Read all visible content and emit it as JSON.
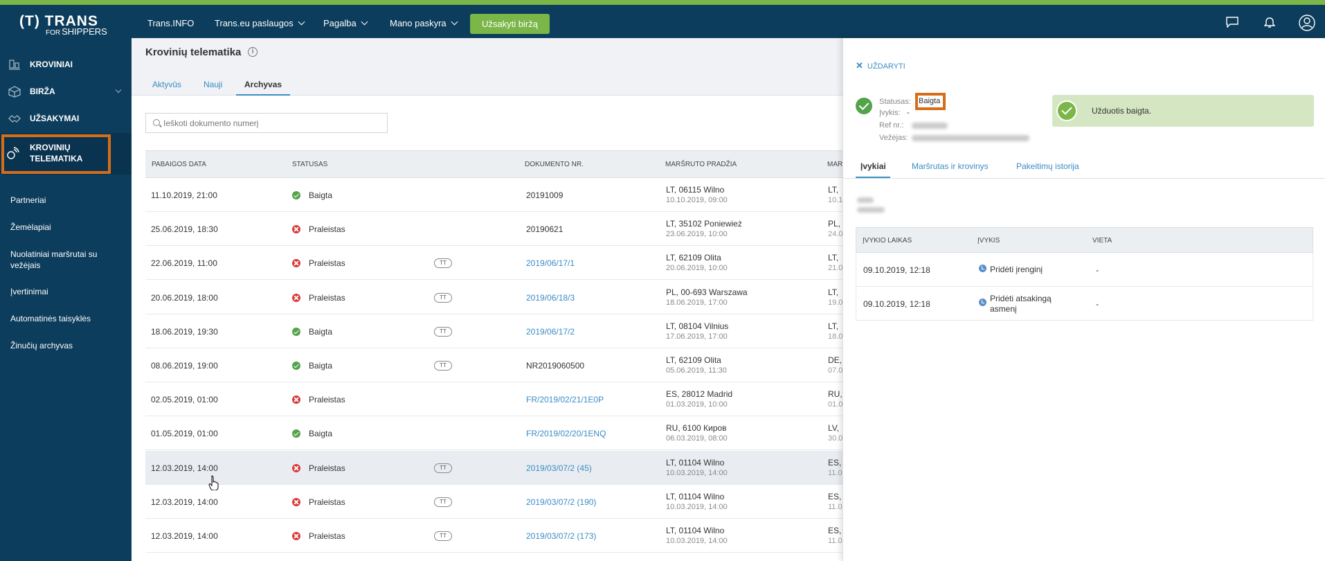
{
  "app": {
    "logo_main": "(T) TRANS",
    "logo_for": "FOR",
    "logo_sub": "SHIPPERS"
  },
  "topnav": {
    "items": [
      {
        "label": "Trans.INFO"
      },
      {
        "label": "Trans.eu paslaugos"
      },
      {
        "label": "Pagalba"
      },
      {
        "label": "Mano paskyra"
      }
    ],
    "order_button": "Užsakyti biržą",
    "icons": [
      "chat-icon",
      "bell-icon",
      "user-icon"
    ]
  },
  "sidebar": {
    "main_items": [
      {
        "label": "KROVINIAI",
        "icon": "cargo-icon"
      },
      {
        "label": "BIRŽA",
        "icon": "box-icon"
      },
      {
        "label": "UŽSAKYMAI",
        "icon": "handshake-icon"
      },
      {
        "label": "KROVINIŲ TELEMATIKA",
        "icon": "satellite-icon"
      }
    ],
    "links": [
      "Partneriai",
      "Žemėlapiai",
      "Nuolatiniai maršrutai su vežėjais",
      "Įvertinimai",
      "Automatinės taisyklės",
      "Žinučių archyvas"
    ]
  },
  "main": {
    "title": "Krovinių telematika",
    "tabs": [
      "Aktyvūs",
      "Nauji",
      "Archyvas"
    ],
    "active_tab": "Archyvas",
    "search_placeholder": "Ieškoti dokumento numerį",
    "columns": [
      "PABAIGOS DATA",
      "STATUSAS",
      "DOKUMENTO NR.",
      "MARŠRUTO PRADŽIA",
      "MARŠ"
    ],
    "rows": [
      {
        "date": "11.10.2019, 21:00",
        "status": "Baigta",
        "ok": true,
        "tt": false,
        "doc": "20191009",
        "link": false,
        "route_from": "LT, 06115 Wilno",
        "route_from_date": "10.10.2019, 09:00",
        "route_to": "LT,",
        "route_to_date": "10.1"
      },
      {
        "date": "25.06.2019, 18:30",
        "status": "Praleistas",
        "ok": false,
        "tt": false,
        "doc": "20190621",
        "link": false,
        "route_from": "LT, 35102 Poniewież",
        "route_from_date": "23.06.2019, 10:00",
        "route_to": "PL,",
        "route_to_date": "24.0"
      },
      {
        "date": "22.06.2019, 11:00",
        "status": "Praleistas",
        "ok": false,
        "tt": true,
        "doc": "2019/06/17/1",
        "link": true,
        "route_from": "LT, 62109 Olita",
        "route_from_date": "20.06.2019, 10:00",
        "route_to": "LT,",
        "route_to_date": "21.0"
      },
      {
        "date": "20.06.2019, 18:00",
        "status": "Praleistas",
        "ok": false,
        "tt": true,
        "doc": "2019/06/18/3",
        "link": true,
        "route_from": "PL, 00-693 Warszawa",
        "route_from_date": "18.06.2019, 17:00",
        "route_to": "LT,",
        "route_to_date": "19.0"
      },
      {
        "date": "18.06.2019, 19:30",
        "status": "Baigta",
        "ok": true,
        "tt": true,
        "doc": "2019/06/17/2",
        "link": true,
        "route_from": "LT, 08104 Vilnius",
        "route_from_date": "17.06.2019, 17:00",
        "route_to": "LT,",
        "route_to_date": "18.0"
      },
      {
        "date": "08.06.2019, 19:00",
        "status": "Baigta",
        "ok": true,
        "tt": true,
        "doc": "NR2019060500",
        "link": false,
        "route_from": "LT, 62109 Olita",
        "route_from_date": "05.06.2019, 11:30",
        "route_to": "DE,",
        "route_to_date": "07.0"
      },
      {
        "date": "02.05.2019, 01:00",
        "status": "Praleistas",
        "ok": false,
        "tt": false,
        "doc": "FR/2019/02/21/1E0P",
        "link": true,
        "route_from": "ES, 28012 Madrid",
        "route_from_date": "01.03.2019, 10:00",
        "route_to": "RU,",
        "route_to_date": "01.0"
      },
      {
        "date": "01.05.2019, 01:00",
        "status": "Baigta",
        "ok": true,
        "tt": false,
        "doc": "FR/2019/02/20/1ENQ",
        "link": true,
        "route_from": "RU, 6100 Киров",
        "route_from_date": "06.03.2019, 08:00",
        "route_to": "LV,",
        "route_to_date": "30.0"
      },
      {
        "date": "12.03.2019, 14:00",
        "status": "Praleistas",
        "ok": false,
        "tt": true,
        "doc": "2019/03/07/2 (45)",
        "link": true,
        "route_from": "LT, 01104 Wilno",
        "route_from_date": "10.03.2019, 14:00",
        "route_to": "ES,",
        "route_to_date": "11.0",
        "highlight": true
      },
      {
        "date": "12.03.2019, 14:00",
        "status": "Praleistas",
        "ok": false,
        "tt": true,
        "doc": "2019/03/07/2 (190)",
        "link": true,
        "route_from": "LT, 01104 Wilno",
        "route_from_date": "10.03.2019, 14:00",
        "route_to": "ES,",
        "route_to_date": "11.0"
      },
      {
        "date": "12.03.2019, 14:00",
        "status": "Praleistas",
        "ok": false,
        "tt": true,
        "doc": "2019/03/07/2 (173)",
        "link": true,
        "route_from": "LT, 01104 Wilno",
        "route_from_date": "10.03.2019, 14:00",
        "route_to": "ES,",
        "route_to_date": "11.0"
      }
    ],
    "tt_label": "TT"
  },
  "panel": {
    "close_label": "UŽDARYTI",
    "status_label": "Statusas:",
    "status_value": "Baigta",
    "event_label": "Įvykis:",
    "event_value": "-",
    "ref_label": "Ref nr.:",
    "carrier_label": "Vežėjas:",
    "alert_text": "Užduotis baigta.",
    "tabs": [
      "Įvykiai",
      "Maršrutas ir krovinys",
      "Pakeitimų istorija"
    ],
    "events_columns": [
      "ĮVYKIO LAIKAS",
      "ĮVYKIS",
      "VIETA"
    ],
    "events": [
      {
        "time": "09.10.2019, 12:18",
        "event": "Pridėti įrenginį",
        "place": "-"
      },
      {
        "time": "09.10.2019, 12:18",
        "event": "Pridėti atsakingą asmenį",
        "place": "-"
      }
    ]
  }
}
